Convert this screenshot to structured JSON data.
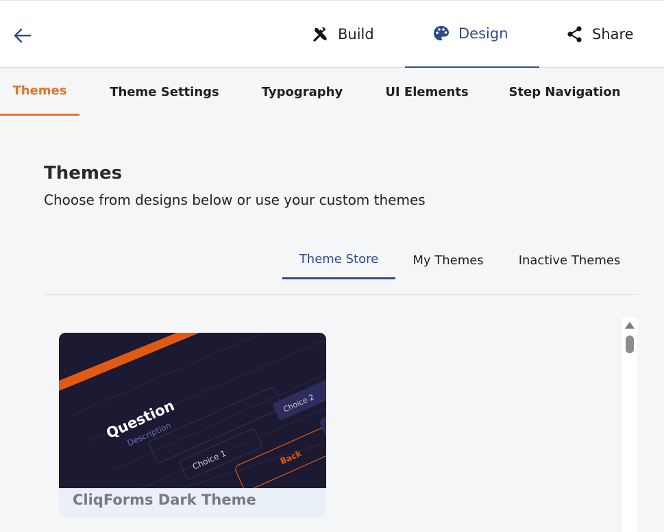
{
  "topbar": {
    "tabs": [
      {
        "label": "Build",
        "icon": "tools-icon"
      },
      {
        "label": "Design",
        "icon": "palette-icon",
        "active": true
      },
      {
        "label": "Share",
        "icon": "share-icon"
      }
    ]
  },
  "subtabs": [
    "Themes",
    "Theme Settings",
    "Typography",
    "UI Elements",
    "Step Navigation"
  ],
  "main": {
    "title": "Themes",
    "subtitle": "Choose from designs below or use your custom themes",
    "inner_tabs": [
      "Theme Store",
      "My Themes",
      "Inactive Themes"
    ],
    "card": {
      "title": "CliqForms Dark Theme",
      "preview": {
        "question": "Question",
        "description": "Description",
        "choice1": "Choice 1",
        "choice2": "Choice 2",
        "back": "Back"
      }
    }
  },
  "colors": {
    "accent": "#e2742a",
    "primary": "#2e4a8a",
    "preview_bg": "#1b1a32"
  }
}
